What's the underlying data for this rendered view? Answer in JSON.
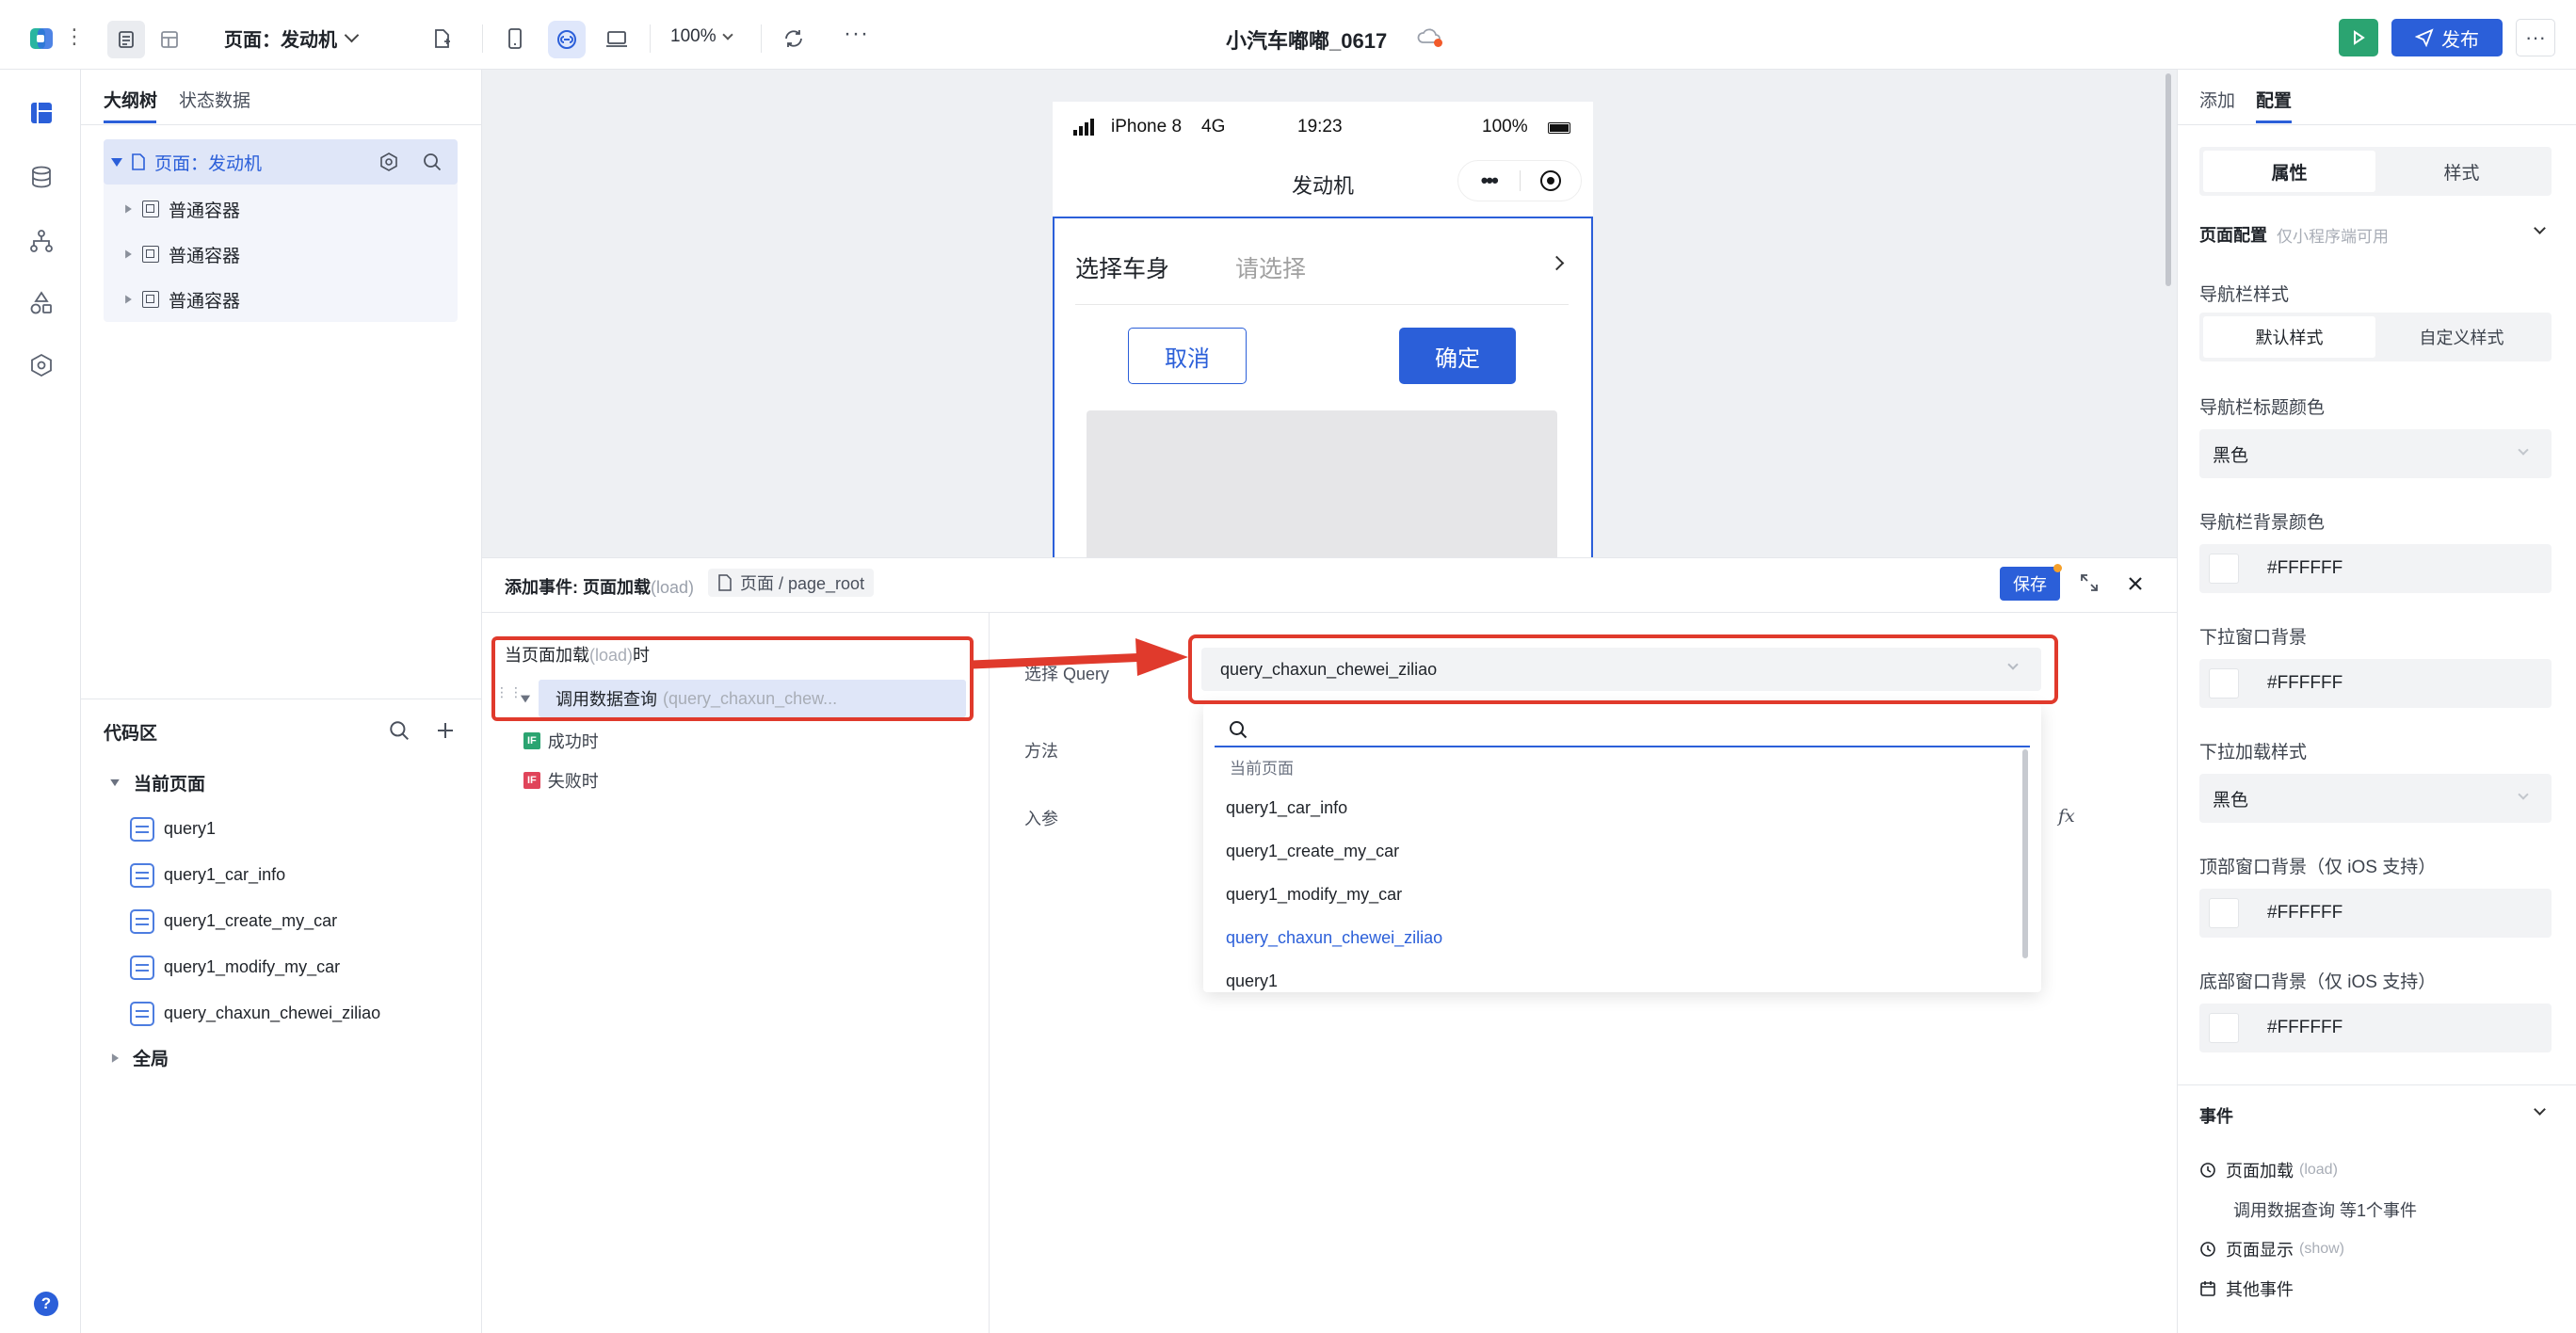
{
  "toolbar": {
    "page_selector": "页面：发动机",
    "zoom": "100%",
    "more": "···",
    "project_title": "小汽车嘟嘟_0617",
    "publish_label": "发布",
    "overflow": "···"
  },
  "left_panel": {
    "tabs": [
      "大纲树",
      "状态数据"
    ],
    "page_node": "页面：发动机",
    "containers": [
      "普通容器",
      "普通容器",
      "普通容器"
    ]
  },
  "code_area": {
    "title": "代码区",
    "current_page": "当前页面",
    "queries": [
      "query1",
      "query1_car_info",
      "query1_create_my_car",
      "query1_modify_my_car",
      "query_chaxun_chewei_ziliao"
    ],
    "global": "全局"
  },
  "phone": {
    "carrier": "iPhone 8",
    "network": "4G",
    "time": "19:23",
    "battery": "100%",
    "nav_title": "发动机",
    "menu_dots": "•••",
    "select_label": "选择车身",
    "select_placeholder": "请选择",
    "cancel_label": "取消",
    "confirm_label": "确定"
  },
  "event_editor": {
    "title_prefix": "添加事件: 页面加载",
    "title_suffix": "(load)",
    "breadcrumb": "页面 / page_root",
    "save_label": "保存",
    "trigger_prefix": "当页面加载",
    "trigger_mid": "(load)",
    "trigger_suffix": "时",
    "action_label": "调用数据查询",
    "action_detail": "(query_chaxun_chew...",
    "success_badge": "IF",
    "success_label": "成功时",
    "fail_badge": "IF",
    "fail_label": "失败时",
    "select_query_label": "选择 Query",
    "method_label": "方法",
    "params_label": "入参",
    "fx": "fx",
    "selected_query": "query_chaxun_chewei_ziliao",
    "dropdown_group": "当前页面",
    "dropdown_options": [
      "query1_car_info",
      "query1_create_my_car",
      "query1_modify_my_car",
      "query_chaxun_chewei_ziliao",
      "query1"
    ]
  },
  "right_panel": {
    "tabs": [
      "添加",
      "配置"
    ],
    "segment": [
      "属性",
      "样式"
    ],
    "section_title": "页面配置",
    "section_note": "仅小程序端可用",
    "nav_style_label": "导航栏样式",
    "nav_style_options": [
      "默认样式",
      "自定义样式"
    ],
    "nav_title_color_label": "导航栏标题颜色",
    "nav_title_color_value": "黑色",
    "nav_bg_color_label": "导航栏背景颜色",
    "nav_bg_color_value": "#FFFFFF",
    "pull_bg_label": "下拉窗口背景",
    "pull_bg_value": "#FFFFFF",
    "pull_style_label": "下拉加载样式",
    "pull_style_value": "黑色",
    "top_bg_label": "顶部窗口背景（仅 iOS 支持）",
    "top_bg_value": "#FFFFFF",
    "bottom_bg_label": "底部窗口背景（仅 iOS 支持）",
    "bottom_bg_value": "#FFFFFF",
    "events_title": "事件",
    "event_load": "页面加载",
    "event_load_tag": "(load)",
    "event_load_detail": "调用数据查询 等1个事件",
    "event_show": "页面显示",
    "event_show_tag": "(show)",
    "other_events": "其他事件"
  },
  "help": "?",
  "colors": {
    "primary": "#2b5fd9",
    "annotation": "#e03a2c",
    "run_green": "#2ba471"
  }
}
